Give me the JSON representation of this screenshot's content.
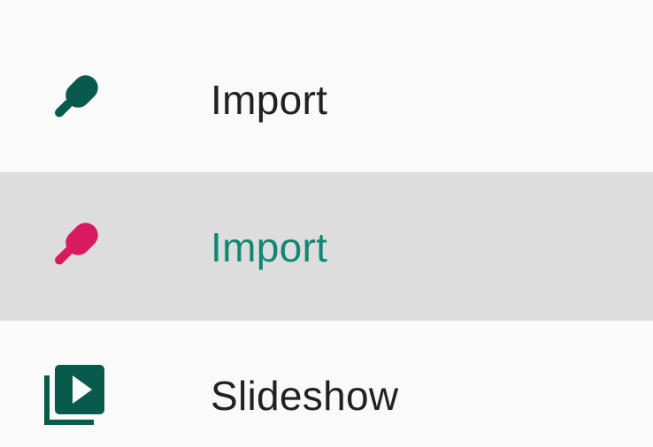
{
  "menu": {
    "items": [
      {
        "label": "Import",
        "icon": "popsicle-icon",
        "icon_color": "#075a4c",
        "label_color": "#212121",
        "selected": false
      },
      {
        "label": "Import",
        "icon": "popsicle-icon",
        "icon_color": "#d81b60",
        "label_color": "#128775",
        "selected": true
      },
      {
        "label": "Slideshow",
        "icon": "slideshow-icon",
        "icon_color": "#075a4c",
        "label_color": "#212121",
        "selected": false
      }
    ]
  },
  "colors": {
    "background": "#fafafa",
    "selected_background": "#dddddd"
  }
}
